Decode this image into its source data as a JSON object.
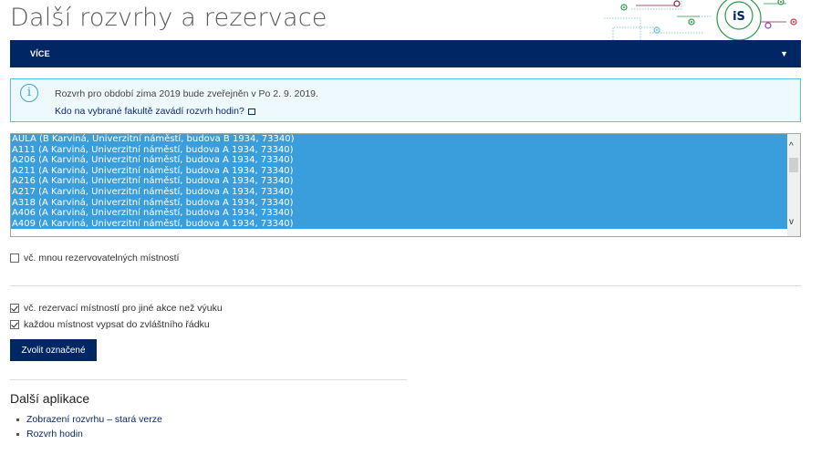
{
  "page": {
    "title": "Další rozvrhy a rezervace",
    "logo_text": "iS"
  },
  "nav": {
    "more_label": "VÍCE",
    "caret": "▼"
  },
  "info": {
    "icon": "info-icon",
    "text": "Rozvrh pro období zima 2019 bude zveřejněn v Po 2. 9. 2019.",
    "link": "Kdo na vybrané fakultě zavádí rozvrh hodin?"
  },
  "rooms": {
    "options": [
      "AULA (B Karviná, Univerzitní náměstí, budova B 1934, 73340)",
      "A111 (A Karviná, Univerzitní náměstí, budova A 1934, 73340)",
      "A206 (A Karviná, Univerzitní náměstí, budova A 1934, 73340)",
      "A211 (A Karviná, Univerzitní náměstí, budova A 1934, 73340)",
      "A216 (A Karviná, Univerzitní náměstí, budova A 1934, 73340)",
      "A217 (A Karviná, Univerzitní náměstí, budova A 1934, 73340)",
      "A318 (A Karviná, Univerzitní náměstí, budova A 1934, 73340)",
      "A406 (A Karviná, Univerzitní náměstí, budova A 1934, 73340)",
      "A409 (A Karviná, Univerzitní náměstí, budova A 1934, 73340)"
    ]
  },
  "options": {
    "include_many": {
      "label": "vč. mnou rezervovatelných místností",
      "checked": false
    },
    "include_other": {
      "label": "vč. rezervací místností pro jiné akce než výuku",
      "checked": true
    },
    "each_row": {
      "label": "každou místnost vypsat do zvláštního řádku",
      "checked": true
    }
  },
  "submit_label": "Zvolit označené",
  "other_apps": {
    "title": "Další aplikace",
    "items": [
      "Zobrazení rozvrhu – stará verze",
      "Rozvrh hodin"
    ]
  },
  "colors": {
    "navy": "#002664",
    "select_blue": "#3a9edc",
    "info_border": "#5bc0de"
  }
}
